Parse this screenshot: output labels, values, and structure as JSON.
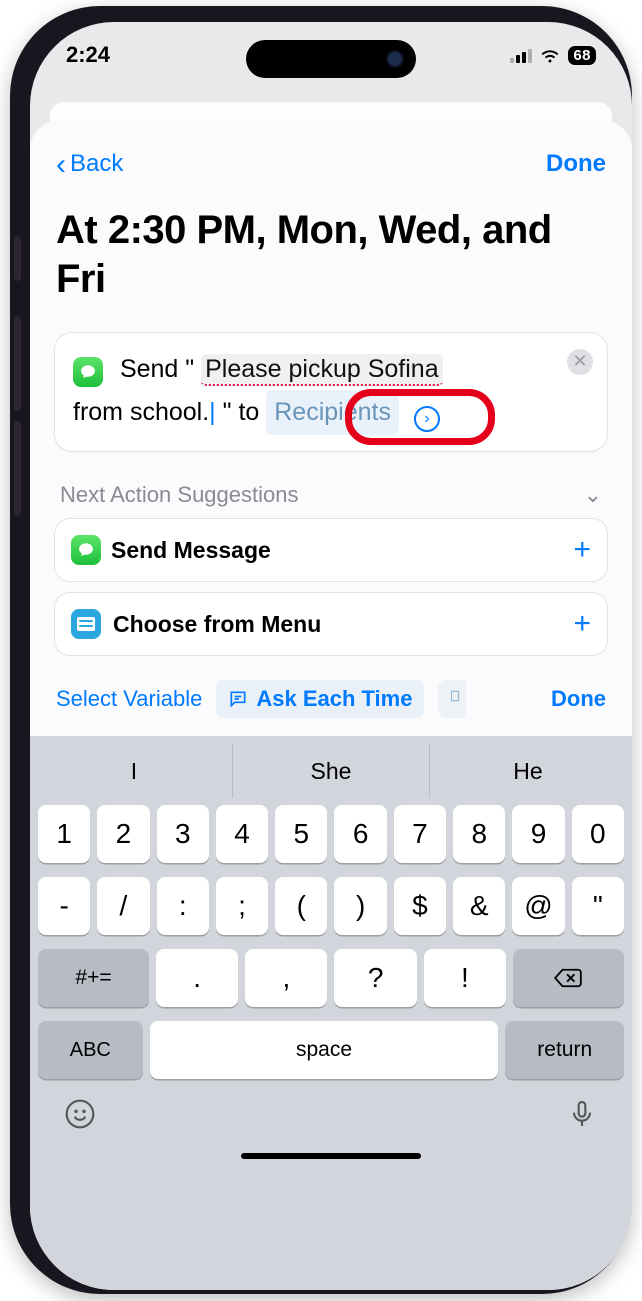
{
  "status": {
    "time": "2:24",
    "battery": "68"
  },
  "nav": {
    "back": "Back",
    "done": "Done"
  },
  "title": "At 2:30 PM, Mon, Wed, and Fri",
  "action": {
    "send_prefix": "Send \"",
    "message_part1": "Please pickup Sofina",
    "message_part2": "from school.",
    "close_quote_to": "\" to",
    "recipients_token": "Recipients"
  },
  "suggestions": {
    "header": "Next Action Suggestions",
    "items": [
      {
        "label": "Send Message",
        "icon": "messages"
      },
      {
        "label": "Choose from Menu",
        "icon": "menu"
      }
    ]
  },
  "variable_bar": {
    "select": "Select Variable",
    "ask": "Ask Each Time",
    "done": "Done"
  },
  "keyboard": {
    "suggestions": [
      "I",
      "She",
      "He"
    ],
    "row1": [
      "1",
      "2",
      "3",
      "4",
      "5",
      "6",
      "7",
      "8",
      "9",
      "0"
    ],
    "row2": [
      "-",
      "/",
      ":",
      ";",
      "(",
      ")",
      "$",
      "&",
      "@",
      "\""
    ],
    "row3_shift": "#+=",
    "row3": [
      ".",
      ",",
      "?",
      "!"
    ],
    "abc": "ABC",
    "space": "space",
    "return": "return"
  }
}
